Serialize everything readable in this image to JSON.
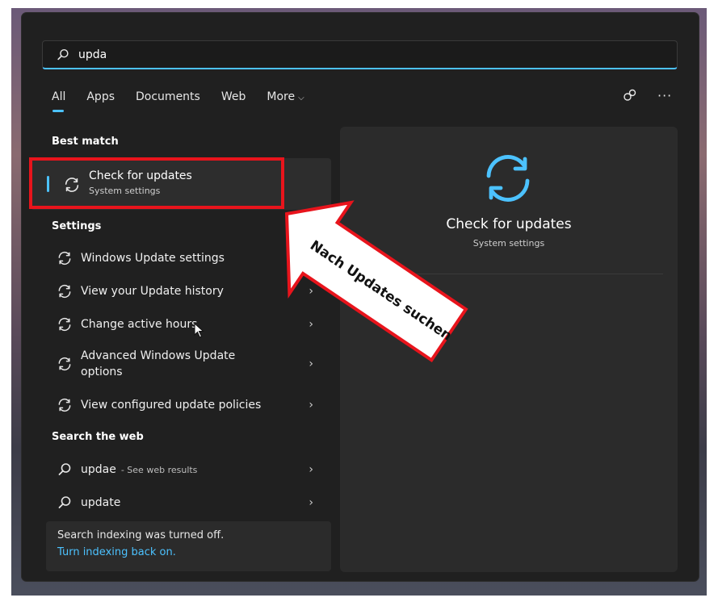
{
  "search": {
    "query": "upda"
  },
  "tabs": [
    {
      "label": "All",
      "active": true
    },
    {
      "label": "Apps"
    },
    {
      "label": "Documents"
    },
    {
      "label": "Web"
    },
    {
      "label": "More",
      "chevron": "⌵"
    }
  ],
  "toolbar": {
    "rewards_icon": "rewards-icon",
    "more_label": "···"
  },
  "sections": {
    "best_match": "Best match",
    "settings": "Settings",
    "search_web": "Search the web"
  },
  "best_match": {
    "title": "Check for updates",
    "subtitle": "System settings"
  },
  "settings_items": [
    {
      "label": "Windows Update settings"
    },
    {
      "label": "View your Update history"
    },
    {
      "label": "Change active hours"
    },
    {
      "label": "Advanced Windows Update options"
    },
    {
      "label": "View configured update policies"
    }
  ],
  "web_items": [
    {
      "label": "updae",
      "hint": "- See web results"
    },
    {
      "label": "update"
    }
  ],
  "footer": {
    "text": "Search indexing was turned off.",
    "link": "Turn indexing back on."
  },
  "detail": {
    "title": "Check for updates",
    "subtitle": "System settings"
  },
  "annotation": {
    "text": "Nach Updates suchen"
  },
  "chevron": "›",
  "colors": {
    "accent": "#4cc2ff",
    "highlight": "#e8141c",
    "panel": "#202020"
  }
}
